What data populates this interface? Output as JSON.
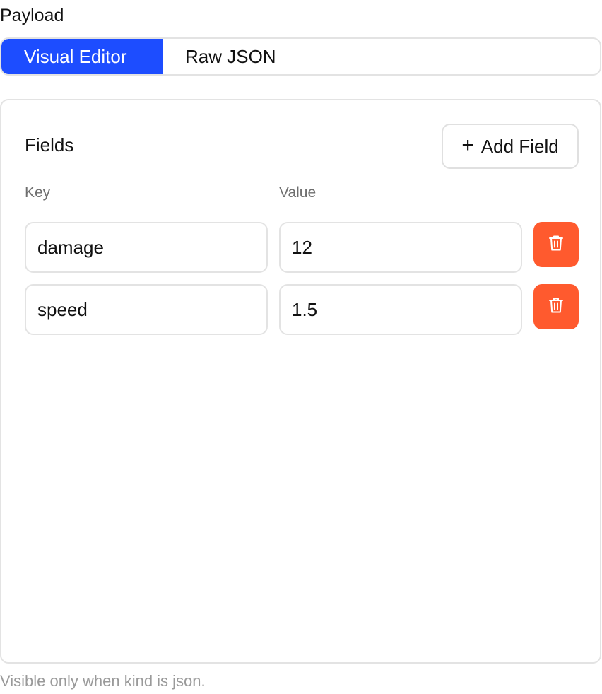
{
  "payload_label": "Payload",
  "tabs": [
    {
      "label": "Visual Editor",
      "active": true
    },
    {
      "label": "Raw JSON",
      "active": false
    }
  ],
  "fields_panel": {
    "title": "Fields",
    "add_button_label": "Add Field",
    "add_button_icon": "plus-icon",
    "columns": {
      "key": "Key",
      "value": "Value"
    },
    "rows": [
      {
        "key": "damage",
        "value": "12",
        "delete_icon": "trash-icon"
      },
      {
        "key": "speed",
        "value": "1.5",
        "delete_icon": "trash-icon"
      }
    ]
  },
  "helper_text": "Visible only when kind is json.",
  "colors": {
    "accent": "#1d4dff",
    "danger": "#ff5a2e",
    "border": "#e3e3e3",
    "muted_text": "#6e6e6e"
  }
}
